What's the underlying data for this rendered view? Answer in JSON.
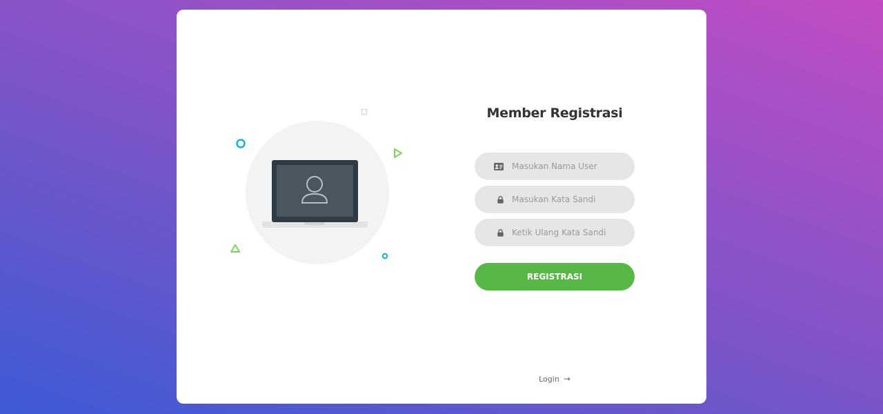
{
  "form": {
    "title": "Member Registrasi",
    "fields": [
      {
        "icon": "id-card-icon",
        "placeholder": "Masukan Nama User",
        "value": ""
      },
      {
        "icon": "lock-icon",
        "placeholder": "Masukan Kata Sandi",
        "value": ""
      },
      {
        "icon": "lock-icon",
        "placeholder": "Ketik Ulang Kata Sandi",
        "value": ""
      }
    ],
    "submit_label": "REGISTRASI",
    "login_label": "Login",
    "login_arrow": "→"
  },
  "colors": {
    "accent": "#57b846",
    "field_bg": "#e6e6e6",
    "title": "#333333",
    "deco_cyan": "#15b2d3",
    "deco_green": "#7dd35a"
  }
}
